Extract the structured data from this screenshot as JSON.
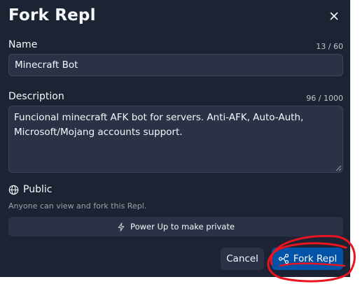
{
  "dialog": {
    "title": "Fork Repl",
    "close_icon": "close-icon"
  },
  "name_field": {
    "label": "Name",
    "counter": "13 / 60",
    "value": "Minecraft Bot"
  },
  "description_field": {
    "label": "Description",
    "counter": "96 / 1000",
    "value": "Funcional minecraft AFK bot for servers. Anti-AFK, Auto-Auth, Microsoft/Mojang accounts support."
  },
  "visibility": {
    "icon": "globe-icon",
    "label": "Public",
    "help_text": "Anyone can view and fork this Repl."
  },
  "power_up": {
    "icon": "lightning-icon",
    "label": "Power Up to make private"
  },
  "actions": {
    "cancel_label": "Cancel",
    "fork_icon": "fork-icon",
    "fork_label": "Fork Repl"
  },
  "colors": {
    "modal_background": "#1c2333",
    "field_background": "#2b3245",
    "primary_button": "#0053a6",
    "annotation_stroke": "#e8141f"
  }
}
